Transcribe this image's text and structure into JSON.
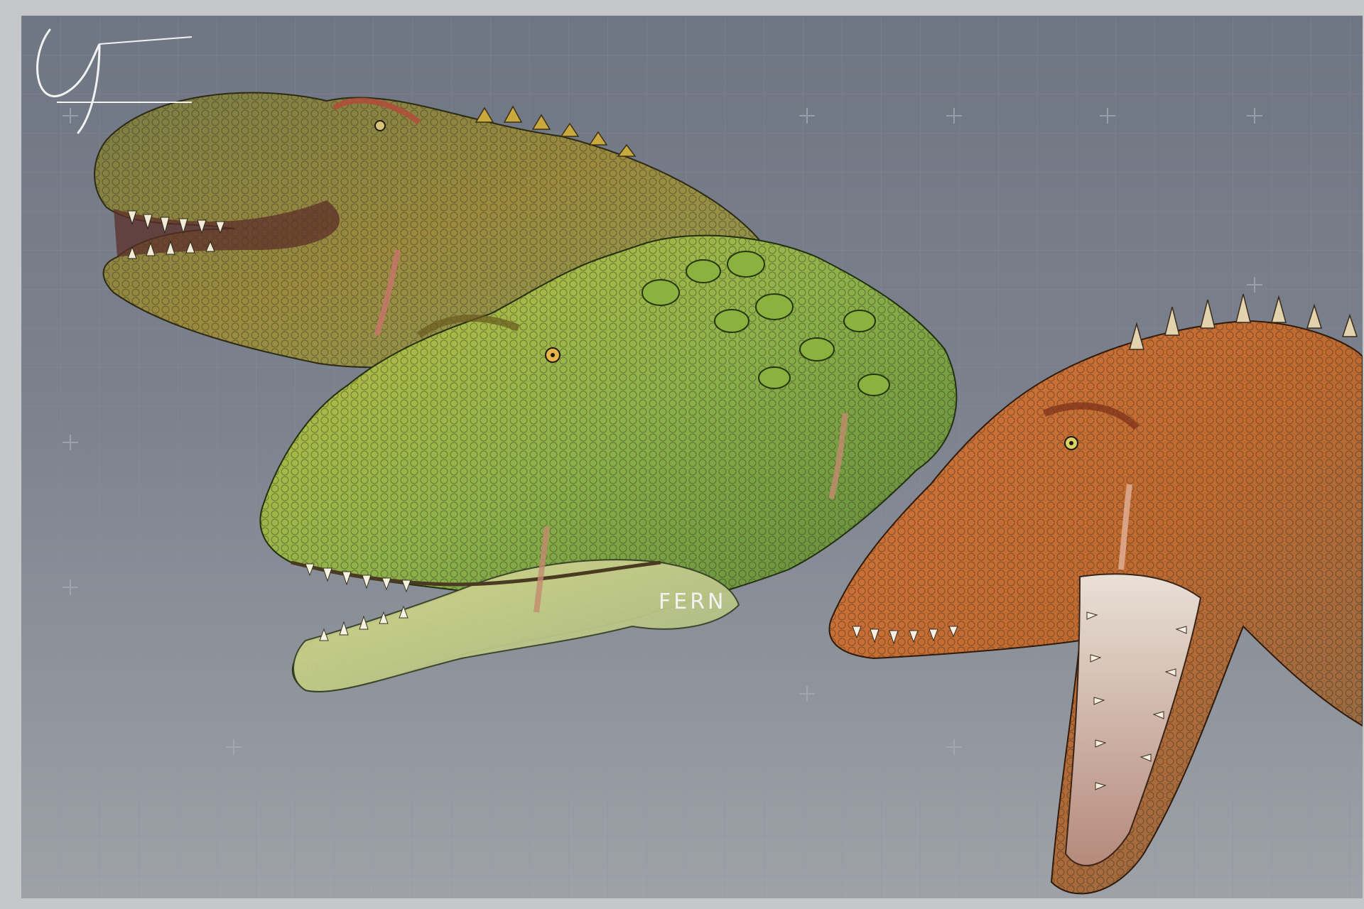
{
  "artwork": {
    "signature": "FERN",
    "colors": {
      "border": "#c6c7c9",
      "background_top": "#6f7683",
      "background_bottom": "#9ea2a8",
      "grid": "#8c929c",
      "head_back": "#8a8a4a",
      "head_middle": "#9aa94a",
      "head_front": "#c46a2e",
      "signature": "#f2f2f2"
    },
    "subjects": [
      {
        "name": "back-dinosaur-head",
        "color": "olive-yellow"
      },
      {
        "name": "middle-dinosaur-head",
        "color": "green"
      },
      {
        "name": "front-dinosaur-head",
        "color": "orange"
      }
    ]
  }
}
